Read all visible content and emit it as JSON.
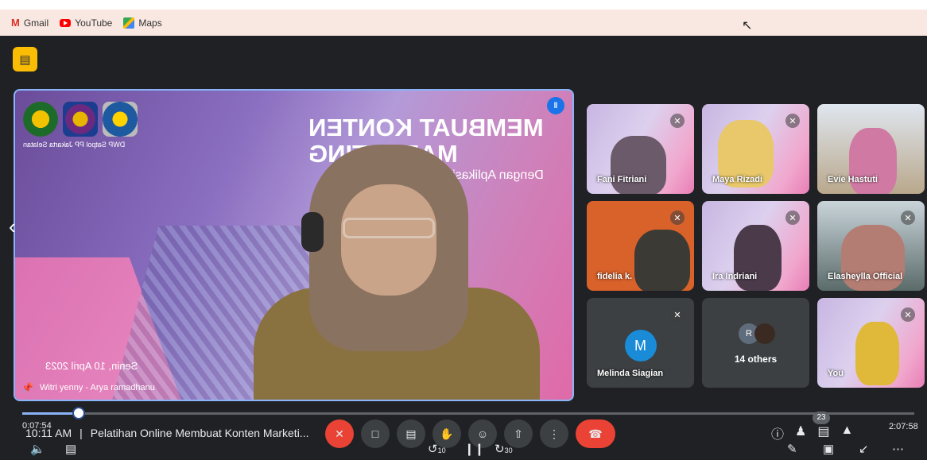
{
  "bookmarks": [
    {
      "label": "Gmail",
      "icon": "gmail-icon"
    },
    {
      "label": "YouTube",
      "icon": "youtube-icon"
    },
    {
      "label": "Maps",
      "icon": "maps-icon"
    }
  ],
  "main_tile": {
    "slide_title_line1": "MEMBUAT KONTEN",
    "slide_title_line2": "MARKETING",
    "slide_subtitle": "Dengan Aplikasi C",
    "logo_caption": "DWP Satpol PP Jakarta Selatan",
    "slide_date": "Senin, 10 April 2023",
    "presenter_name": "Witri yenny - Arya ramadhanu"
  },
  "participants": [
    {
      "name": "Fani Fitriani",
      "bg": "slide",
      "muted": true
    },
    {
      "name": "Maya Rizadi",
      "bg": "slide",
      "muted": true
    },
    {
      "name": "Evie Hastuti",
      "bg": "room",
      "muted": false
    },
    {
      "name": "fidelia k.",
      "bg": "orange",
      "muted": true
    },
    {
      "name": "Ira Indriani",
      "bg": "slide",
      "muted": true
    },
    {
      "name": "Elasheylla Official",
      "bg": "car",
      "muted": true
    },
    {
      "name": "Melinda Siagian",
      "avatar": "M",
      "muted": true
    },
    {
      "name": "14 others",
      "avatar": "R",
      "muted": false
    },
    {
      "name": "You",
      "bg": "slide",
      "muted": true
    }
  ],
  "meeting": {
    "clock": "10:11 AM",
    "separator": "|",
    "title": "Pelatihan Online Membuat Konten Marketi...",
    "people_count": "23"
  },
  "player": {
    "elapsed": "0:07:54",
    "total": "2:07:58",
    "progress": 0.063,
    "rewind_label": "10",
    "forward_label": "30"
  },
  "colors": {
    "accent": "#8ab4f8",
    "danger": "#ea4335",
    "camera_off": "#fbbc04"
  }
}
